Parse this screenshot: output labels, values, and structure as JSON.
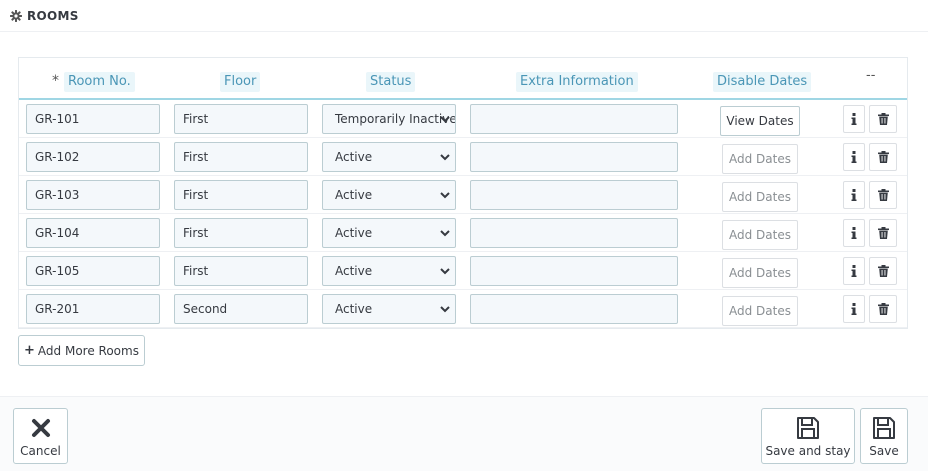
{
  "panel": {
    "title": "ROOMS",
    "icon": "gear-icon"
  },
  "table": {
    "headers": {
      "required_mark": "*",
      "room_no": "Room No.",
      "floor": "Floor",
      "status": "Status",
      "extra_info": "Extra Information",
      "disable_dates": "Disable Dates",
      "actions": "--"
    },
    "rows": [
      {
        "room": "GR-101",
        "floor": "First",
        "status": "Temporarily Inactive",
        "extra": "",
        "dates_btn": "View Dates"
      },
      {
        "room": "GR-102",
        "floor": "First",
        "status": "Active",
        "extra": "",
        "dates_btn": "Add Dates"
      },
      {
        "room": "GR-103",
        "floor": "First",
        "status": "Active",
        "extra": "",
        "dates_btn": "Add Dates"
      },
      {
        "room": "GR-104",
        "floor": "First",
        "status": "Active",
        "extra": "",
        "dates_btn": "Add Dates"
      },
      {
        "room": "GR-105",
        "floor": "First",
        "status": "Active",
        "extra": "",
        "dates_btn": "Add Dates"
      },
      {
        "room": "GR-201",
        "floor": "Second",
        "status": "Active",
        "extra": "",
        "dates_btn": "Add Dates"
      }
    ]
  },
  "add_more": {
    "label": "Add More Rooms"
  },
  "footer": {
    "cancel": "Cancel",
    "save_and_stay": "Save and stay",
    "save": "Save"
  },
  "colors": {
    "header_text": "#4a96b6",
    "header_underline": "#9fd6e4",
    "required": "#e3311d",
    "input_bg": "#f4f8fb"
  }
}
